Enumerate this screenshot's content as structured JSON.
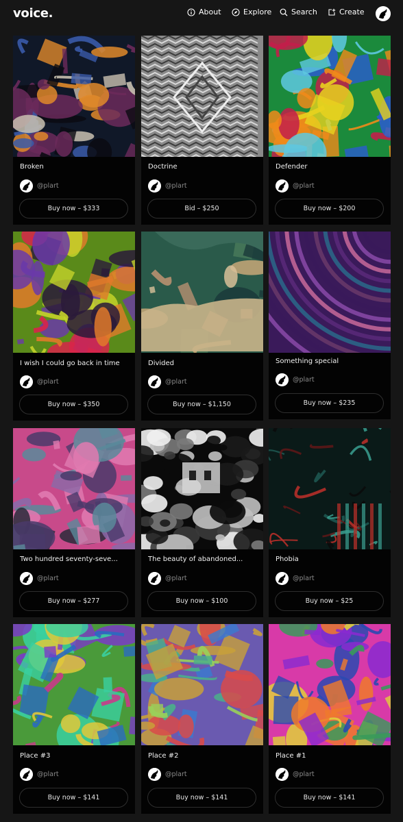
{
  "header": {
    "logo": "voice.",
    "nav": [
      {
        "label": "About",
        "icon": "info-circle-icon"
      },
      {
        "label": "Explore",
        "icon": "compass-icon"
      },
      {
        "label": "Search",
        "icon": "search-icon"
      },
      {
        "label": "Create",
        "icon": "create-icon"
      }
    ],
    "avatar_icon": "user-avatar-icon"
  },
  "colors": {
    "background": "#161616",
    "card": "#030303",
    "button_border": "#2e2e2e",
    "username": "#8a8a8a"
  },
  "cards": [
    {
      "title": "Broken",
      "user": "@plart",
      "action": "Buy now – $333"
    },
    {
      "title": "Doctrine",
      "user": "@plart",
      "action": "Bid – $250"
    },
    {
      "title": "Defender",
      "user": "@plart",
      "action": "Buy now – $200"
    },
    {
      "title": "I wish I could go back in time",
      "user": "@plart",
      "action": "Buy now – $350"
    },
    {
      "title": "Divided",
      "user": "@plart",
      "action": "Buy now – $1,150"
    },
    {
      "title": "Something special",
      "user": "@plart",
      "action": "Buy now – $235"
    },
    {
      "title": "Two hundred seventy-seve...",
      "user": "@plart",
      "action": "Buy now – $277"
    },
    {
      "title": "The beauty of abandoned...",
      "user": "@plart",
      "action": "Buy now – $100"
    },
    {
      "title": "Phobia",
      "user": "@plart",
      "action": "Buy now – $25"
    },
    {
      "title": "Place #3",
      "user": "@plart",
      "action": "Buy now – $141"
    },
    {
      "title": "Place #2",
      "user": "@plart",
      "action": "Buy now – $141"
    },
    {
      "title": "Place #1",
      "user": "@plart",
      "action": "Buy now – $141"
    }
  ]
}
